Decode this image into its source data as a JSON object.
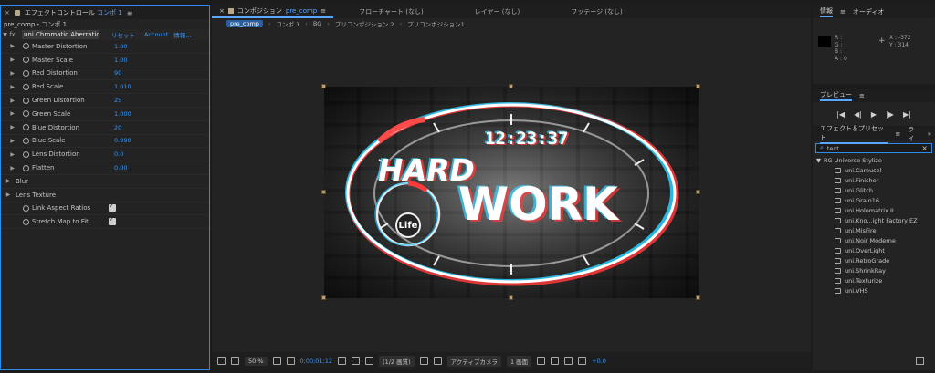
{
  "effect_controls": {
    "tab_title": "エフェクトコントロール",
    "tab_comp": "コンポ 1",
    "breadcrumb": "pre_comp・コンポ 1",
    "effect": {
      "name": "uni.Chromatic Aberration",
      "reset": "リセット",
      "account": "Account",
      "info": "情報..."
    },
    "params": [
      {
        "label": "Master Distortion",
        "value": "1.00"
      },
      {
        "label": "Master Scale",
        "value": "1.00"
      },
      {
        "label": "Red Distortion",
        "value": "90"
      },
      {
        "label": "Red Scale",
        "value": "1.010"
      },
      {
        "label": "Green Distortion",
        "value": "25"
      },
      {
        "label": "Green Scale",
        "value": "1.000"
      },
      {
        "label": "Blue Distortion",
        "value": "20"
      },
      {
        "label": "Blue Scale",
        "value": "0.990"
      },
      {
        "label": "Lens Distortion",
        "value": "0.0"
      },
      {
        "label": "Flatten",
        "value": "0.00"
      }
    ],
    "groups": [
      "Blur",
      "Lens Texture"
    ],
    "checks": [
      {
        "label": "Link Aspect Ratios",
        "checked": true
      },
      {
        "label": "Stretch Map to Fit",
        "checked": true
      }
    ]
  },
  "composition": {
    "tab_label": "コンポジション",
    "tab_name": "pre_comp",
    "other_tabs": [
      "フローチャート (なし)",
      "レイヤー (なし)",
      "フッテージ (なし)"
    ],
    "crumbs": [
      "pre_comp",
      "コンポ 1",
      "BG",
      "プリコンポジション 2",
      "プリコンポジション1"
    ],
    "artwork": {
      "clock": "12:23:37",
      "line1": "HARD",
      "line2": "WORK",
      "badge": "Life"
    },
    "footer": {
      "zoom": "50 %",
      "timecode": "0;00;01;12",
      "resolution": "(1/2 画質)",
      "camera": "アクティブカメラ",
      "views": "1 画面",
      "exposure": "+0.0"
    }
  },
  "info_panel": {
    "tabs": [
      "情報",
      "オーディオ"
    ],
    "rgb": [
      "R :",
      "G :",
      "B :",
      "A : 0"
    ],
    "xy": [
      "X : -372",
      "Y : 314"
    ]
  },
  "preview_panel": {
    "title": "プレビュー",
    "controls": [
      "|◀",
      "◀|",
      "▶",
      "|▶",
      "▶|"
    ]
  },
  "effects_presets": {
    "tabs": [
      "エフェクト＆プリセット",
      "ライ"
    ],
    "search": "text",
    "category": "RG Universe Stylize",
    "items": [
      "uni.Carousel",
      "uni.Finisher",
      "uni.Glitch",
      "uni.Grain16",
      "uni.Holomatrix II",
      "uni.Kno...ight Factory EZ",
      "uni.MisFire",
      "uni.Noir Moderne",
      "uni.OverLight",
      "uni.RetroGrade",
      "uni.ShrinkRay",
      "uni.Texturize",
      "uni.VHS"
    ]
  }
}
